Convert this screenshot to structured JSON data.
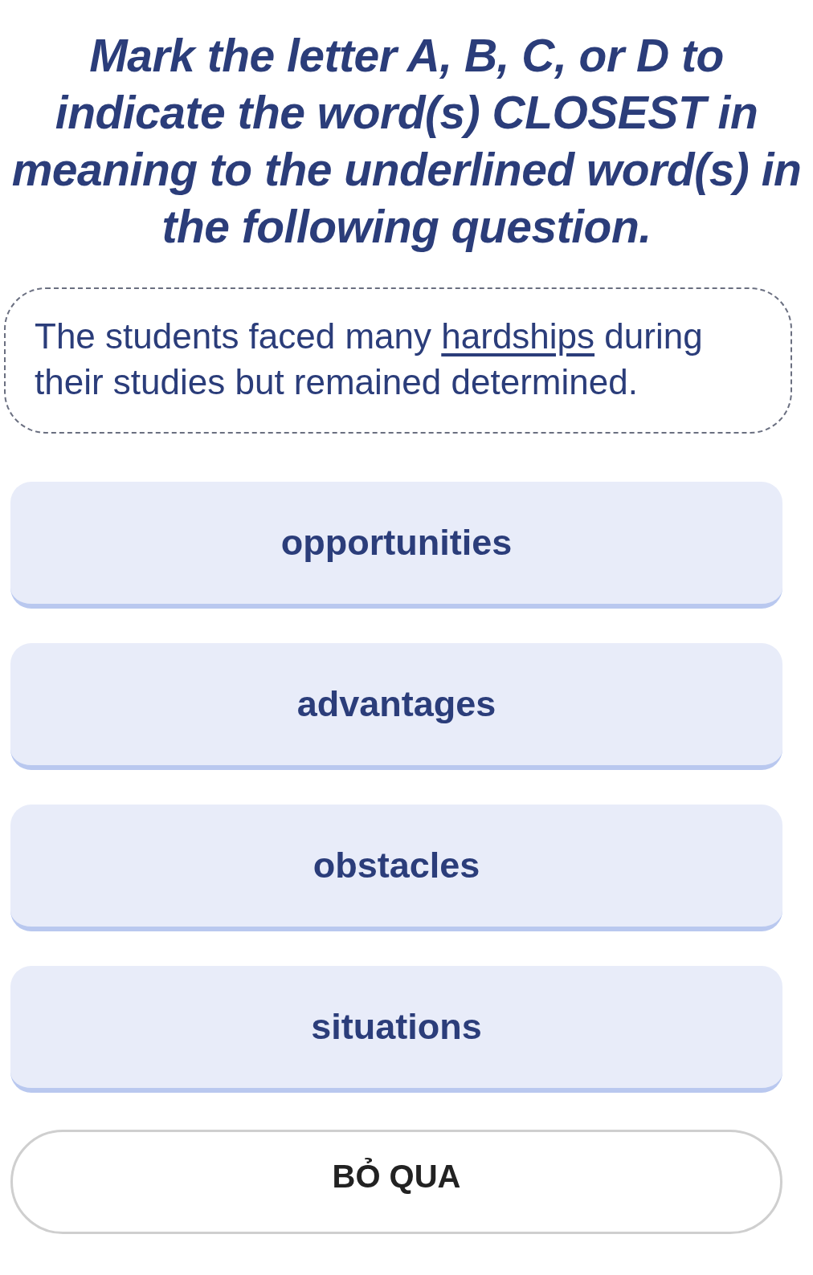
{
  "instruction": "Mark the letter A, B, C, or D to indicate the word(s) CLOSEST in meaning to the underlined word(s) in the following question.",
  "question": {
    "parts": [
      {
        "text": "The students faced many ",
        "underlined": false
      },
      {
        "text": "hardships",
        "underlined": true
      },
      {
        "text": " during their studies but remained determined.",
        "underlined": false
      }
    ]
  },
  "options": [
    {
      "label": "opportunities",
      "selected": false
    },
    {
      "label": "advantages",
      "selected": false
    },
    {
      "label": "obstacles",
      "selected": false
    },
    {
      "label": "situations",
      "selected": false
    }
  ],
  "skip_button": "BỎ QUA"
}
